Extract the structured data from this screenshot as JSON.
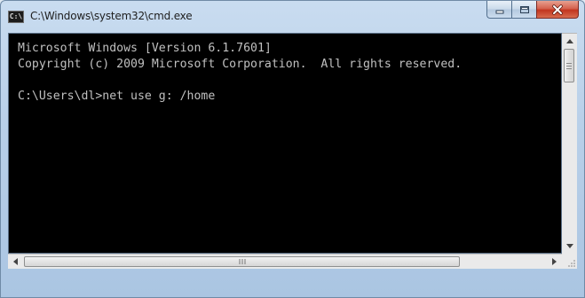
{
  "window": {
    "icon_text": "C:\\",
    "title": "C:\\Windows\\system32\\cmd.exe"
  },
  "console": {
    "lines": [
      "Microsoft Windows [Version 6.1.7601]",
      "Copyright (c) 2009 Microsoft Corporation.  All rights reserved.",
      "",
      "C:\\Users\\dl>net use g: /home"
    ]
  },
  "colors": {
    "console_background": "#000000",
    "console_text": "#c0c0c0",
    "close_button": "#c2351f"
  },
  "icons": [
    "cmd-app-icon",
    "minimize-icon",
    "maximize-icon",
    "close-icon",
    "arrow-up-icon",
    "arrow-down-icon",
    "arrow-left-icon",
    "arrow-right-icon",
    "resize-grip-icon"
  ]
}
